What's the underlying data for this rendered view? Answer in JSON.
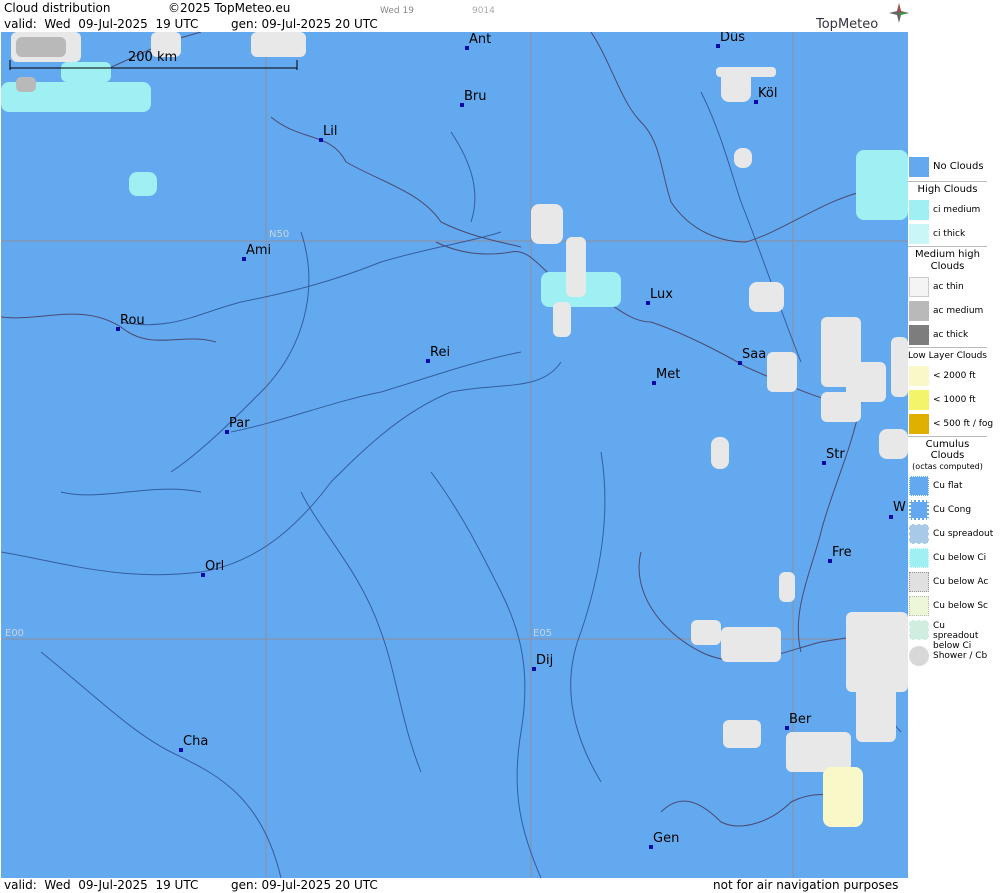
{
  "header": {
    "title": "Cloud distribution",
    "copyright": "©2025 TopMeteo.eu",
    "valid": "valid:  Wed  09-Jul-2025  19 UTC",
    "generated": "gen: 09-Jul-2025 20 UTC",
    "tab_day": "Wed 19",
    "tab_code": "9014",
    "brand": "TopMeteo"
  },
  "map": {
    "scale_label": "200 km",
    "grid_labels": {
      "lat_n50": "N50",
      "lon_e00": "E00",
      "lon_e05": "E05"
    },
    "cities": [
      {
        "id": "ant",
        "label": "Ant"
      },
      {
        "id": "dus",
        "label": "Düs"
      },
      {
        "id": "bru",
        "label": "Bru"
      },
      {
        "id": "kol",
        "label": "Köl"
      },
      {
        "id": "lil",
        "label": "Lil"
      },
      {
        "id": "ami",
        "label": "Ami"
      },
      {
        "id": "lux",
        "label": "Lux"
      },
      {
        "id": "rou",
        "label": "Rou"
      },
      {
        "id": "rei",
        "label": "Rei"
      },
      {
        "id": "saa",
        "label": "Saa"
      },
      {
        "id": "met",
        "label": "Met"
      },
      {
        "id": "par",
        "label": "Par"
      },
      {
        "id": "str",
        "label": "Str"
      },
      {
        "id": "w",
        "label": "W"
      },
      {
        "id": "fre",
        "label": "Fre"
      },
      {
        "id": "orl",
        "label": "Orl"
      },
      {
        "id": "dij",
        "label": "Dij"
      },
      {
        "id": "ber",
        "label": "Ber"
      },
      {
        "id": "cha",
        "label": "Cha"
      },
      {
        "id": "gen",
        "label": "Gen"
      }
    ],
    "colors": {
      "no_clouds": "#63a9ef",
      "ci_medium": "#9ef0f2",
      "ac": "#e8e8e8",
      "low_2000": "#f8f8c8"
    }
  },
  "legend": {
    "no_clouds": "No Clouds",
    "high_clouds": "High Clouds",
    "ci_medium": "ci medium",
    "ci_thick": "ci thick",
    "medium_high": "Medium high Clouds",
    "ac_thin": "ac thin",
    "ac_medium": "ac medium",
    "ac_thick": "ac thick",
    "low_layer": "Low Layer Clouds",
    "low_2000": "< 2000 ft",
    "low_1000": "< 1000 ft",
    "low_500": "< 500 ft / fog",
    "cumulus": "Cumulus Clouds",
    "cumulus_sub": "(octas computed)",
    "cu_flat": "Cu flat",
    "cu_cong": "Cu Cong",
    "cu_spreadout": "Cu spreadout",
    "cu_below_ci": "Cu below Ci",
    "cu_below_ac": "Cu below Ac",
    "cu_below_sc": "Cu below Sc",
    "cu_spreadout_below_ci": "Cu spreadout below Ci",
    "shower": "Shower / Cb"
  },
  "footer": {
    "valid": "valid:  Wed  09-Jul-2025  19 UTC",
    "generated": "gen: 09-Jul-2025 20 UTC",
    "disclaimer": "not for air navigation purposes"
  }
}
